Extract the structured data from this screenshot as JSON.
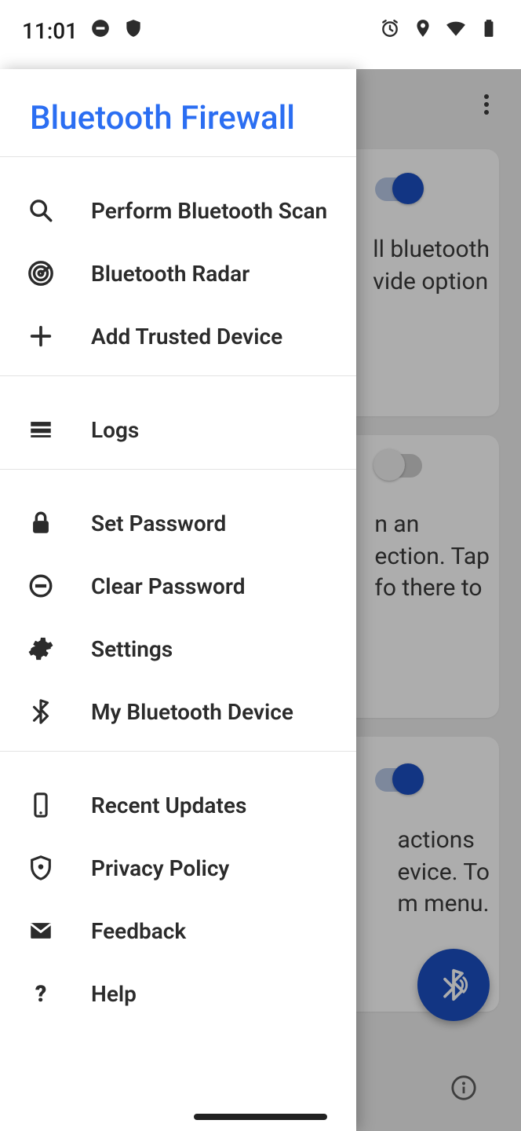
{
  "status": {
    "time": "11:01"
  },
  "drawer": {
    "title": "Bluetooth Firewall",
    "groups": [
      {
        "items": [
          {
            "id": "scan",
            "label": "Perform Bluetooth Scan"
          },
          {
            "id": "radar",
            "label": "Bluetooth Radar"
          },
          {
            "id": "add",
            "label": "Add Trusted Device"
          }
        ]
      },
      {
        "items": [
          {
            "id": "logs",
            "label": "Logs"
          }
        ]
      },
      {
        "items": [
          {
            "id": "setpw",
            "label": "Set Password"
          },
          {
            "id": "clrpw",
            "label": "Clear Password"
          },
          {
            "id": "settings",
            "label": "Settings"
          },
          {
            "id": "mydev",
            "label": "My Bluetooth Device"
          }
        ]
      },
      {
        "items": [
          {
            "id": "updates",
            "label": "Recent Updates"
          },
          {
            "id": "privacy",
            "label": "Privacy Policy"
          },
          {
            "id": "feedback",
            "label": "Feedback"
          },
          {
            "id": "help",
            "label": "Help"
          }
        ]
      }
    ]
  },
  "underlying": {
    "card1": {
      "text_lines": "ll bluetooth\nvide option",
      "toggle": true
    },
    "card2": {
      "text_lines": "n an\nection. Tap\nfo there to",
      "toggle": false
    },
    "card3": {
      "text_lines": "actions\nevice. To\nm menu.",
      "toggle": true
    }
  }
}
